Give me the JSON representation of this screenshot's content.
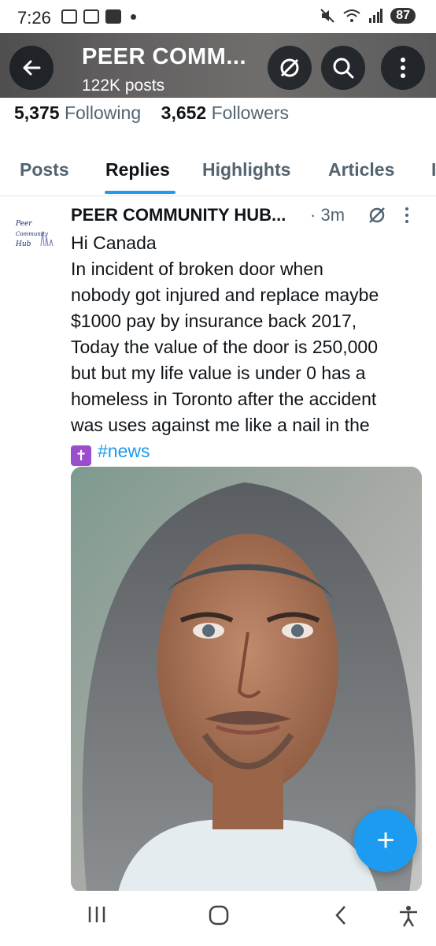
{
  "status_bar": {
    "time": "7:26",
    "battery": "87",
    "icons": [
      "calendar-icon",
      "screenshot-icon",
      "youtube-icon",
      "dot-icon",
      "mute-icon",
      "wifi-icon",
      "signal-icon"
    ]
  },
  "header": {
    "title": "PEER COMM...",
    "subtitle": "122K posts",
    "icons": [
      "back-arrow-icon",
      "grok-icon",
      "search-icon",
      "more-vertical-icon"
    ]
  },
  "profile_stats": {
    "following_count": "5,375",
    "following_label": "Following",
    "followers_count": "3,652",
    "followers_label": "Followers"
  },
  "tabs": {
    "items": [
      {
        "label": "Posts",
        "active": false
      },
      {
        "label": "Replies",
        "active": true
      },
      {
        "label": "Highlights",
        "active": false
      },
      {
        "label": "Articles",
        "active": false
      }
    ],
    "accent_color": "#1d9bf0"
  },
  "post": {
    "author": "PEER COMMUNITY HUB...",
    "separator": "·",
    "time": "3m",
    "avatar_text": [
      "Peer",
      "Community",
      "Hub"
    ],
    "lines": [
      "Hi Canada",
      "In incident of broken door when",
      "nobody got injured and replace maybe",
      "$1000 pay by insurance back 2017,",
      "Today the value of the door is  250,000",
      "but but my life value is under 0 has a",
      "homeless in Toronto after the accident",
      "was uses against me like a nail in the"
    ],
    "last_line_emoji": "✝",
    "hashtag": "#news"
  },
  "fab": {
    "icon": "plus-icon",
    "label": "+"
  },
  "nav_bar": {
    "icons": [
      "recent-apps-icon",
      "home-icon",
      "back-icon",
      "accessibility-icon"
    ]
  }
}
